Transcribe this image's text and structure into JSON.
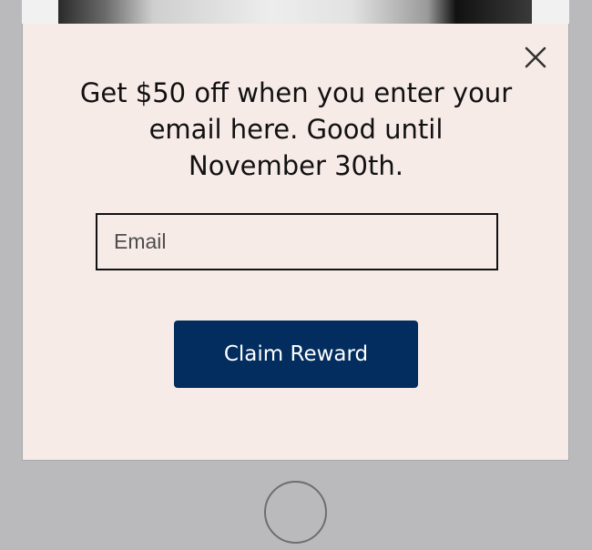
{
  "popup": {
    "headline": "Get $50 off when you enter your email here. Good until November 30th.",
    "email_placeholder": "Email",
    "email_value": "",
    "submit_label": "Claim Reward",
    "close_icon": "close-icon"
  },
  "device": {
    "home_button_icon": "home-button-circle"
  },
  "colors": {
    "modal_background": "#f7ebe8",
    "button_background": "#022d5e",
    "button_text": "#ffffff",
    "device_frame": "#bab9bc"
  }
}
